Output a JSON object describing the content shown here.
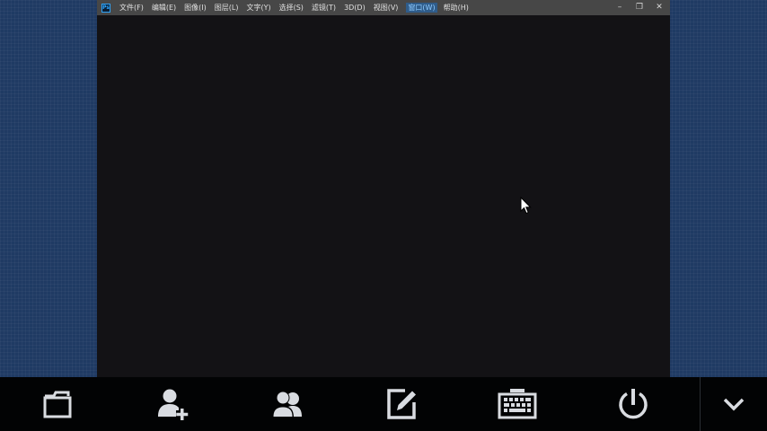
{
  "app": {
    "logo_text": "Ps",
    "menu": [
      {
        "label": "文件(F)"
      },
      {
        "label": "编辑(E)"
      },
      {
        "label": "图像(I)"
      },
      {
        "label": "图层(L)"
      },
      {
        "label": "文字(Y)"
      },
      {
        "label": "选择(S)"
      },
      {
        "label": "滤镜(T)"
      },
      {
        "label": "3D(D)"
      },
      {
        "label": "视图(V)"
      },
      {
        "label": "窗口(W)"
      },
      {
        "label": "帮助(H)"
      }
    ],
    "window_controls": {
      "minimize": "–",
      "restore": "❐",
      "close": "✕"
    }
  },
  "taskbar": {
    "buttons": [
      {
        "icon": "window-icon"
      },
      {
        "icon": "add-user-icon"
      },
      {
        "icon": "users-icon"
      },
      {
        "icon": "edit-icon"
      },
      {
        "icon": "keyboard-icon"
      },
      {
        "icon": "power-icon"
      },
      {
        "icon": "chevron-down-icon"
      }
    ]
  },
  "colors": {
    "desktop": "#1f3a63",
    "menubar": "#474747",
    "canvas": "#131215",
    "taskbar": "#020304",
    "icon": "#d9dce1"
  }
}
